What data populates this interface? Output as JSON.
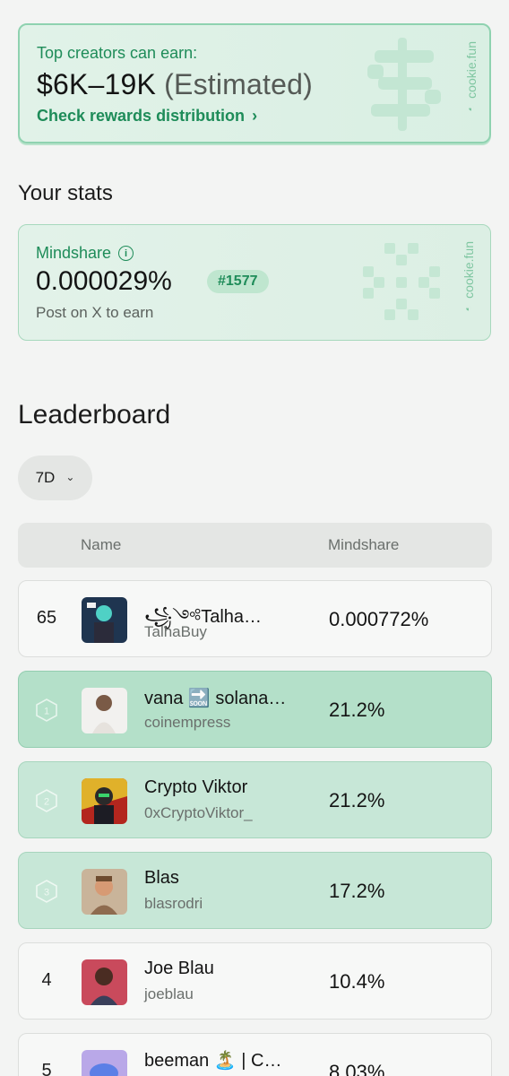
{
  "earn_card": {
    "label": "Top creators can earn:",
    "amount": "$6K–19K",
    "estimated": "(Estimated)",
    "link": "Check rewards distribution",
    "brand": "cookie.fun"
  },
  "stats": {
    "title": "Your stats",
    "mindshare_label": "Mindshare",
    "mindshare_value": "0.000029%",
    "rank_badge": "#1577",
    "subtitle": "Post on X to earn",
    "brand": "cookie.fun"
  },
  "leaderboard": {
    "title": "Leaderboard",
    "period": "7D",
    "columns": {
      "name": "Name",
      "mindshare": "Mindshare"
    },
    "my_row": {
      "rank": "65",
      "name": "꧁༺Talha…",
      "handle": "TalhaBuy",
      "share": "0.000772%"
    },
    "rows": [
      {
        "rank": "1",
        "name": "vana 🔜 solana…",
        "handle": "coinempress",
        "share": "21.2%"
      },
      {
        "rank": "2",
        "name": "Crypto Viktor",
        "handle": "0xCryptoViktor_",
        "share": "21.2%"
      },
      {
        "rank": "3",
        "name": "Blas",
        "handle": "blasrodri",
        "share": "17.2%"
      },
      {
        "rank": "4",
        "name": "Joe Blau",
        "handle": "joeblau",
        "share": "10.4%"
      },
      {
        "rank": "5",
        "name": "beeman 🏝️ | C…",
        "handle": "",
        "share": "8.03%"
      }
    ]
  },
  "colors": {
    "accent": "#1e8c59",
    "card_bg": "#dcefe4",
    "top_row": "#c7e7d7"
  },
  "icons": {
    "info": "info-icon",
    "chevron": "chevron-right-icon",
    "dropdown": "chevron-down-icon",
    "rank_badge": "hexagon-icon"
  }
}
